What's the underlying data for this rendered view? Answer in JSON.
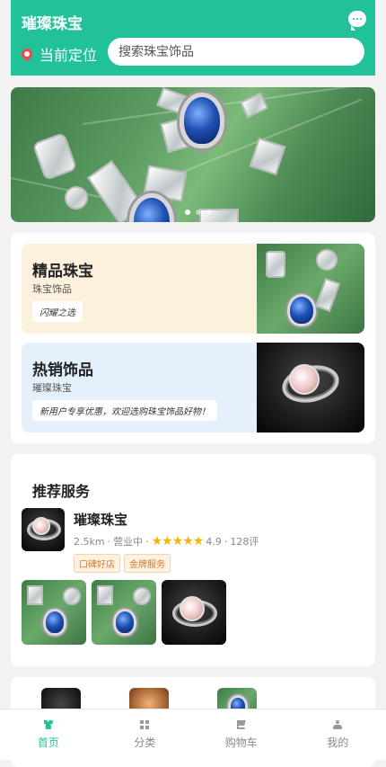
{
  "header": {
    "title": "璀璨珠宝",
    "location_label": "当前定位",
    "search_placeholder": "搜索珠宝饰品"
  },
  "banner": {
    "slides": 3,
    "active_slide": 1
  },
  "categories": [
    {
      "title": "精品珠宝",
      "subtitle": "珠宝饰品",
      "tag": "闪耀之选",
      "bg": "#fdf0dd"
    },
    {
      "title": "热销饰品",
      "subtitle": "璀璨珠宝",
      "tag": "新用户专享优惠，欢迎选购珠宝饰品好物！",
      "bg": "#e4f0fb"
    }
  ],
  "recommend": {
    "section_title": "推荐服务",
    "shop": {
      "name": "璀璨珠宝",
      "distance": "2.5km",
      "status": "营业中",
      "rating_stars": "★★★★★",
      "rating": "4.9",
      "reviews": "128评",
      "badges": [
        "口碑好店",
        "金牌服务"
      ]
    }
  },
  "tabbar": {
    "tabs": [
      {
        "label": "首页",
        "icon": "shirt-icon",
        "active": true
      },
      {
        "label": "分类",
        "icon": "grid-icon",
        "active": false
      },
      {
        "label": "购物车",
        "icon": "cart-icon",
        "active": false
      },
      {
        "label": "我的",
        "icon": "user-icon",
        "active": false
      }
    ]
  },
  "colors": {
    "brand": "#21c29a",
    "star": "#f5b400",
    "badge_text": "#e07a1e"
  }
}
